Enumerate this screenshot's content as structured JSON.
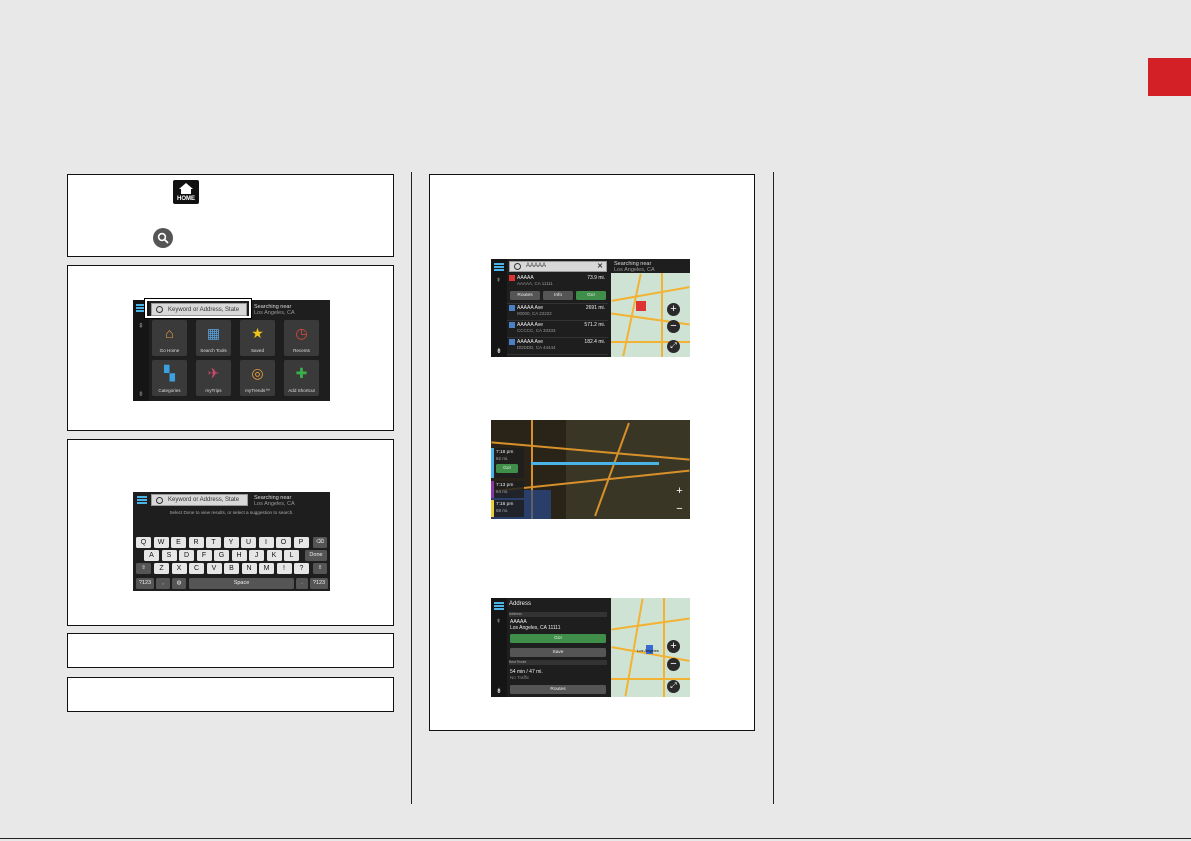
{
  "page": {
    "accent_color": "#d31f26"
  },
  "steps": {
    "home_icon_label": "HOME",
    "search_icon": "search-icon"
  },
  "fig_home": {
    "search_placeholder": "Keyword or Address, State",
    "searching_near_line1": "Searching near",
    "searching_near_line2": "Los Angeles, CA",
    "tiles": [
      {
        "label": "Go Home",
        "icon": "home-icon",
        "color": "#e8a13a"
      },
      {
        "label": "Search Tools",
        "icon": "search-tools-icon",
        "color": "#5aa0d8"
      },
      {
        "label": "Saved",
        "icon": "star-icon",
        "color": "#f0c419"
      },
      {
        "label": "Recents",
        "icon": "clock-icon",
        "color": "#e04a3a"
      },
      {
        "label": "Categories",
        "icon": "categories-icon",
        "color": "#3aa0e0"
      },
      {
        "label": "myTrips",
        "icon": "trips-icon",
        "color": "#d04a6a"
      },
      {
        "label": "myTrends™",
        "icon": "trends-icon",
        "color": "#e8a13a"
      },
      {
        "label": "Add Shortcut",
        "icon": "plus-icon",
        "color": "#3ab04a"
      }
    ]
  },
  "fig_keyboard": {
    "search_placeholder": "Keyword or Address, State",
    "searching_near_line1": "Searching near",
    "searching_near_line2": "Los Angeles, CA",
    "hint": "Select Done to view results, or select a suggestion to search.",
    "row1": [
      "Q",
      "W",
      "E",
      "R",
      "T",
      "Y",
      "U",
      "I",
      "O",
      "P"
    ],
    "row2": [
      "A",
      "S",
      "D",
      "F",
      "G",
      "H",
      "J",
      "K",
      "L"
    ],
    "row3": [
      "Z",
      "X",
      "C",
      "V",
      "B",
      "N",
      "M",
      "!",
      "?"
    ],
    "done_label": "Done",
    "symbols_label": "?123",
    "comma_label": ",",
    "period_label": ".",
    "space_label": "Space"
  },
  "fig_results": {
    "search_value": "AAAAA",
    "searching_near_line1": "Searching near",
    "searching_near_line2": "Los Angeles, CA",
    "results": [
      {
        "name": "AAAAA",
        "address": "AAAAA, CA 11111",
        "distance": "73.9 mi."
      },
      {
        "name": "AAAAA Ave",
        "address": "00000, CA 22222",
        "distance": "2691 mi."
      },
      {
        "name": "AAAAA Ave",
        "address": "CCCCC, CA 33333",
        "distance": "571.2 mi."
      },
      {
        "name": "AAAAA Ave",
        "address": "DDDDD, CA 44444",
        "distance": "182.4 mi."
      }
    ],
    "btn_routes": "Routes",
    "btn_info": "Info",
    "btn_go": "Go!"
  },
  "fig_routes": {
    "routes": [
      {
        "time": "7:18 pm",
        "dist": "62 mi.",
        "color": "#4ab3e8"
      },
      {
        "time": "7:13 pm",
        "dist": "64 mi.",
        "color": "#8a3aa8"
      },
      {
        "time": "7:16 pm",
        "dist": "68 mi.",
        "color": "#e8d03a"
      }
    ],
    "go_label": "Go!"
  },
  "fig_address": {
    "title": "Address",
    "section_label": "Address",
    "name": "AAAAA",
    "address": "Los Angeles, CA 11111",
    "go_label": "Go!",
    "save_label": "Save",
    "section2_label": "Best Route",
    "eta": "54 min / 47 mi.",
    "traffic": "No Traffic",
    "routes_label": "Routes",
    "map_label": "Los Angeles"
  }
}
